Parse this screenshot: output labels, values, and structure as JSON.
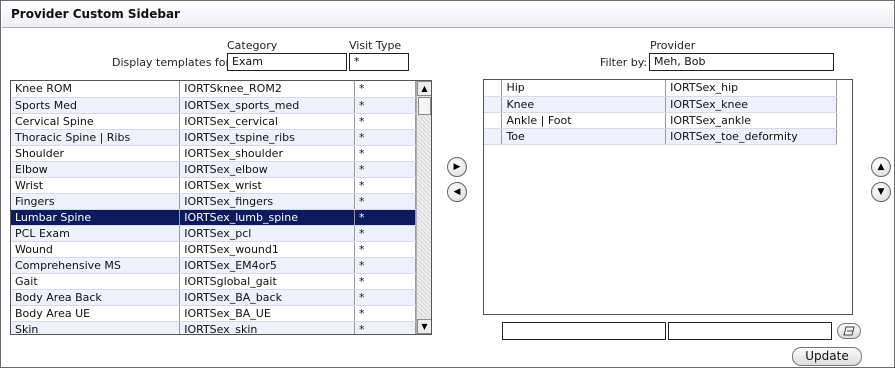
{
  "title": "Provider Custom Sidebar",
  "left": {
    "category_label": "Category",
    "visit_type_label": "Visit Type",
    "display_label": "Display templates for:",
    "category_value": "Exam",
    "visit_type_value": "*",
    "rows": [
      {
        "name": "Knee ROM",
        "template": "IORTSknee_ROM2",
        "visit": "*"
      },
      {
        "name": "Sports Med",
        "template": "IORTSex_sports_med",
        "visit": "*"
      },
      {
        "name": "Cervical Spine",
        "template": "IORTSex_cervical",
        "visit": "*"
      },
      {
        "name": "Thoracic Spine | Ribs",
        "template": "IORTSex_tspine_ribs",
        "visit": "*"
      },
      {
        "name": "Shoulder",
        "template": "IORTSex_shoulder",
        "visit": "*"
      },
      {
        "name": "Elbow",
        "template": "IORTSex_elbow",
        "visit": "*"
      },
      {
        "name": "Wrist",
        "template": "IORTSex_wrist",
        "visit": "*"
      },
      {
        "name": "Fingers",
        "template": "IORTSex_fingers",
        "visit": "*"
      },
      {
        "name": "Lumbar Spine",
        "template": "IORTSex_lumb_spine",
        "visit": "*"
      },
      {
        "name": "PCL Exam",
        "template": "IORTSex_pcl",
        "visit": "*"
      },
      {
        "name": "Wound",
        "template": "IORTSex_wound1",
        "visit": "*"
      },
      {
        "name": "Comprehensive MS",
        "template": "IORTSex_EM4or5",
        "visit": "*"
      },
      {
        "name": "Gait",
        "template": "IORTSglobal_gait",
        "visit": "*"
      },
      {
        "name": "Body Area Back",
        "template": "IORTSex_BA_back",
        "visit": "*"
      },
      {
        "name": "Body Area UE",
        "template": "IORTSex_BA_UE",
        "visit": "*"
      },
      {
        "name": "Skin",
        "template": "IORTSex_skin",
        "visit": "*"
      }
    ],
    "selected_index": 8
  },
  "right": {
    "provider_label": "Provider",
    "filter_label": "Filter by:",
    "provider_value": "Meh, Bob",
    "rows": [
      {
        "name": "Hip",
        "template": "IORTSex_hip"
      },
      {
        "name": "Knee",
        "template": "IORTSex_knee"
      },
      {
        "name": "Ankle | Foot",
        "template": "IORTSex_ankle"
      },
      {
        "name": "Toe",
        "template": "IORTSex_toe_deformity"
      }
    ],
    "edit_name_value": "",
    "edit_template_value": ""
  },
  "buttons": {
    "update_label": "Update"
  },
  "icons": {
    "move_right": "arrow-right-icon",
    "move_left": "arrow-left-icon",
    "move_up": "arrow-up-icon",
    "move_down": "arrow-down-icon",
    "clear": "eraser-icon"
  }
}
